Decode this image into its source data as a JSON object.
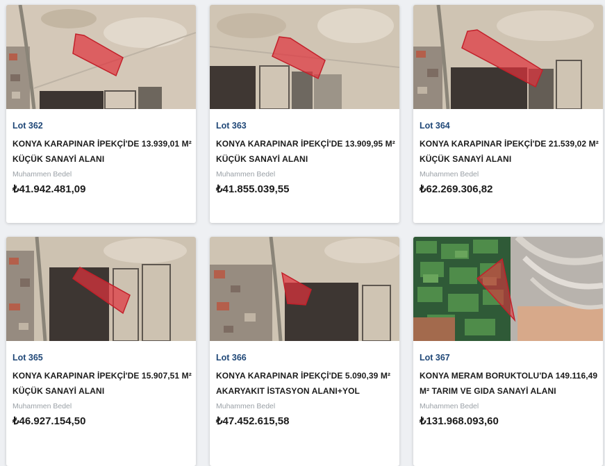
{
  "price_label": "Muhammen Bedel",
  "colors": {
    "lot_text": "#1f4777",
    "overlay_red": "#e0323c",
    "page_bg": "#eef0f3"
  },
  "lots": [
    {
      "lot": "Lot 362",
      "title_line1": "KONYA KARAPINAR İPEKÇİ'DE 13.939,01 M²",
      "title_line2": "KÜÇÜK SANAYİ ALANI",
      "price": "₺41.942.481,09",
      "image": "satellite-map-desert"
    },
    {
      "lot": "Lot 363",
      "title_line1": "KONYA KARAPINAR İPEKÇİ'DE 13.909,95 M²",
      "title_line2": "KÜÇÜK SANAYİ ALANI",
      "price": "₺41.855.039,55",
      "image": "satellite-map-desert"
    },
    {
      "lot": "Lot 364",
      "title_line1": "KONYA KARAPINAR İPEKÇİ'DE 21.539,02 M²",
      "title_line2": "KÜÇÜK SANAYİ ALANI",
      "price": "₺62.269.306,82",
      "image": "satellite-map-desert"
    },
    {
      "lot": "Lot 365",
      "title_line1": "KONYA KARAPINAR İPEKÇİ'DE 15.907,51 M²",
      "title_line2": "KÜÇÜK SANAYİ ALANI",
      "price": "₺46.927.154,50",
      "image": "satellite-map-desert"
    },
    {
      "lot": "Lot 366",
      "title_line1": "KONYA KARAPINAR İPEKÇİ'DE 5.090,39 M²",
      "title_line2": "AKARYAKIT İSTASYON ALANI+YOL",
      "price": "₺47.452.615,58",
      "image": "satellite-map-desert"
    },
    {
      "lot": "Lot 367",
      "title_line1": "KONYA MERAM BORUKTOLU'DA 149.116,49",
      "title_line2": "M² TARIM VE GIDA SANAYİ ALANI",
      "price": "₺131.968.093,60",
      "image": "satellite-map-farmland"
    }
  ]
}
